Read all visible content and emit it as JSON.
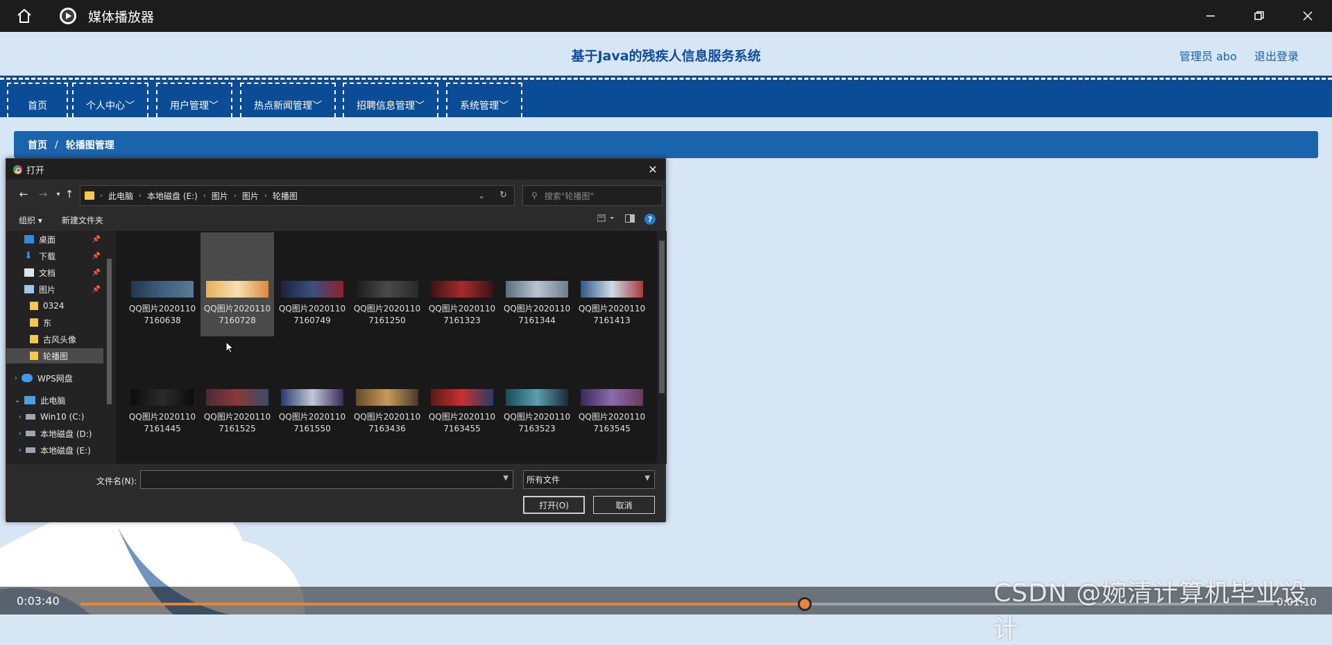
{
  "player": {
    "title": "媒体播放器",
    "time_current": "0:03:40",
    "time_total": "0:01:10",
    "progress": 0.607,
    "accent": "#e8853a"
  },
  "site": {
    "title": "基于Java的残疾人信息服务系统",
    "admin": "管理员 abo",
    "logout": "退出登录",
    "nav": [
      "首页",
      "个人中心",
      "用户管理",
      "热点新闻管理",
      "招聘信息管理",
      "系统管理"
    ],
    "breadcrumb": [
      "首页",
      "轮播图管理"
    ],
    "breadcrumb_sep": "/",
    "primary_color": "#0a4d96"
  },
  "dialog": {
    "title": "打开",
    "path": [
      "此电脑",
      "本地磁盘 (E:)",
      "图片",
      "图片",
      "轮播图"
    ],
    "search_placeholder": "搜索\"轮播图\"",
    "organize": "组织",
    "new_folder": "新建文件夹",
    "nav_items": [
      "桌面",
      "下载",
      "文档",
      "图片",
      "0324",
      "东",
      "古风头像",
      "轮播图",
      "WPS网盘",
      "此电脑",
      "Win10 (C:)",
      "本地磁盘 (D:)",
      "本地磁盘 (E:)"
    ],
    "files": [
      "QQ图片20201107160638",
      "QQ图片20201107160728",
      "QQ图片20201107160749",
      "QQ图片20201107161250",
      "QQ图片20201107161323",
      "QQ图片20201107161344",
      "QQ图片20201107161413",
      "QQ图片20201107161445",
      "QQ图片20201107161525",
      "QQ图片20201107161550",
      "QQ图片20201107163436",
      "QQ图片20201107163455",
      "QQ图片20201107163523",
      "QQ图片20201107163545"
    ],
    "filename_label": "文件名(N):",
    "filename_value": "",
    "filetype": "所有文件",
    "open_button": "打开(O)",
    "cancel_button": "取消"
  },
  "watermark": "CSDN @婉清计算机毕业设计"
}
